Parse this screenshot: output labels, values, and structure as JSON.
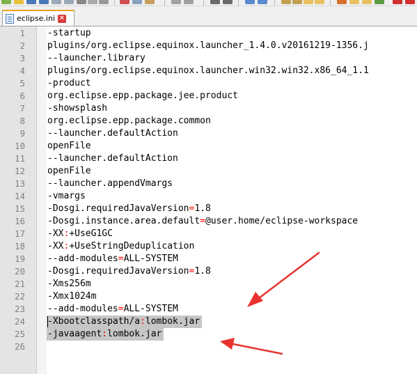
{
  "tab": {
    "filename": "eclipse.ini",
    "close_glyph": "✕"
  },
  "colors": {
    "operator": "#ff0000",
    "selection": "#c6c6c6",
    "annotation_arrow": "#e8322d",
    "tab_active_border": "#f0a020"
  },
  "editor": {
    "lines": [
      {
        "num": "1",
        "parts": [
          {
            "t": "-startup"
          }
        ]
      },
      {
        "num": "2",
        "parts": [
          {
            "t": "plugins/org.eclipse.equinox.launcher_1.4.0.v20161219-1356.j"
          }
        ]
      },
      {
        "num": "3",
        "parts": [
          {
            "t": "--launcher.library"
          }
        ]
      },
      {
        "num": "4",
        "parts": [
          {
            "t": "plugins/org.eclipse.equinox.launcher.win32.win32.x86_64_1.1"
          }
        ]
      },
      {
        "num": "5",
        "parts": [
          {
            "t": "-product"
          }
        ]
      },
      {
        "num": "6",
        "parts": [
          {
            "t": "org.eclipse.epp.package.jee.product"
          }
        ]
      },
      {
        "num": "7",
        "parts": [
          {
            "t": "-showsplash"
          }
        ]
      },
      {
        "num": "8",
        "parts": [
          {
            "t": "org.eclipse.epp.package.common"
          }
        ]
      },
      {
        "num": "9",
        "parts": [
          {
            "t": "--launcher.defaultAction"
          }
        ]
      },
      {
        "num": "10",
        "parts": [
          {
            "t": "openFile"
          }
        ]
      },
      {
        "num": "11",
        "parts": [
          {
            "t": "--launcher.defaultAction"
          }
        ]
      },
      {
        "num": "12",
        "parts": [
          {
            "t": "openFile"
          }
        ]
      },
      {
        "num": "13",
        "parts": [
          {
            "t": "--launcher.appendVmargs"
          }
        ]
      },
      {
        "num": "14",
        "parts": [
          {
            "t": "-vmargs"
          }
        ]
      },
      {
        "num": "15",
        "parts": [
          {
            "t": "-Dosgi.requiredJavaVersion"
          },
          {
            "t": "=",
            "op": true
          },
          {
            "t": "1.8"
          }
        ]
      },
      {
        "num": "16",
        "parts": [
          {
            "t": "-Dosgi.instance.area.default"
          },
          {
            "t": "=",
            "op": true
          },
          {
            "t": "@user.home/eclipse-workspace"
          }
        ]
      },
      {
        "num": "17",
        "parts": [
          {
            "t": "-XX"
          },
          {
            "t": ":",
            "op": true
          },
          {
            "t": "+UseG1GC"
          }
        ]
      },
      {
        "num": "18",
        "parts": [
          {
            "t": "-XX"
          },
          {
            "t": ":",
            "op": true
          },
          {
            "t": "+UseStringDeduplication"
          }
        ]
      },
      {
        "num": "19",
        "parts": [
          {
            "t": "--add-modules"
          },
          {
            "t": "=",
            "op": true
          },
          {
            "t": "ALL-SYSTEM"
          }
        ]
      },
      {
        "num": "20",
        "parts": [
          {
            "t": "-Dosgi.requiredJavaVersion"
          },
          {
            "t": "=",
            "op": true
          },
          {
            "t": "1.8"
          }
        ]
      },
      {
        "num": "21",
        "parts": [
          {
            "t": "-Xms256m"
          }
        ]
      },
      {
        "num": "22",
        "parts": [
          {
            "t": "-Xmx1024m"
          }
        ]
      },
      {
        "num": "23",
        "parts": [
          {
            "t": "--add-modules"
          },
          {
            "t": "=",
            "op": true
          },
          {
            "t": "ALL-SYSTEM"
          }
        ]
      },
      {
        "num": "24",
        "selected": true,
        "parts": [
          {
            "t": "-Xbootclasspath/a"
          },
          {
            "t": ":",
            "op": true
          },
          {
            "t": "lombok.jar"
          }
        ]
      },
      {
        "num": "25",
        "selected": true,
        "parts": [
          {
            "t": "-javaagent"
          },
          {
            "t": ":",
            "op": true
          },
          {
            "t": "lombok.jar"
          }
        ]
      },
      {
        "num": "26",
        "parts": []
      }
    ]
  }
}
